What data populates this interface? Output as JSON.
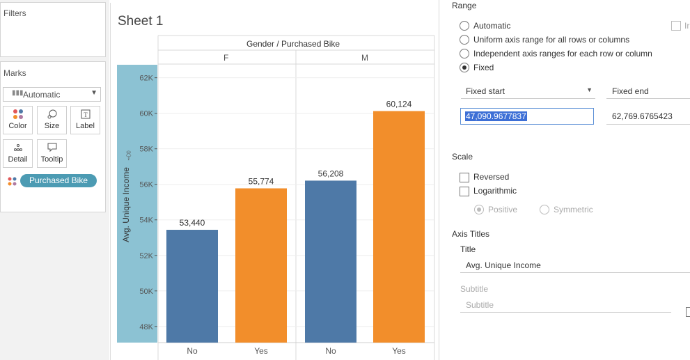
{
  "left_pane": {
    "filters_title": "Filters",
    "marks_title": "Marks",
    "mark_type": "Automatic",
    "mark_buttons": [
      "Color",
      "Size",
      "Label",
      "Detail",
      "Tooltip"
    ],
    "pill_label": "Purchased Bike"
  },
  "sheet": {
    "title": "Sheet 1",
    "column_header": "Gender / Purchased Bike",
    "panes": [
      "F",
      "M"
    ],
    "x_labels": [
      "No",
      "Yes",
      "No",
      "Yes"
    ]
  },
  "chart_data": {
    "type": "bar",
    "ylabel": "Avg. Unique Income",
    "ylim": [
      47090.9677837,
      62769.6765423
    ],
    "y_ticks": [
      48000,
      50000,
      52000,
      54000,
      56000,
      58000,
      60000,
      62000
    ],
    "y_tick_labels": [
      "48K",
      "50K",
      "52K",
      "54K",
      "56K",
      "58K",
      "60K",
      "62K"
    ],
    "categories": [
      "F / No",
      "F / Yes",
      "M / No",
      "M / Yes"
    ],
    "values": [
      53440,
      55774,
      56208,
      60124
    ],
    "value_labels": [
      "53,440",
      "55,774",
      "56,208",
      "60,124"
    ],
    "colors": [
      "#4e79a7",
      "#f28e2b",
      "#4e79a7",
      "#f28e2b"
    ]
  },
  "format_pane": {
    "range_title": "Range",
    "range_options": [
      "Automatic",
      "Uniform axis range for all rows or columns",
      "Independent axis ranges for each row or column",
      "Fixed"
    ],
    "range_selected": "Fixed",
    "include_label": "Ir",
    "fixed_start_label": "Fixed start",
    "fixed_end_label": "Fixed end",
    "fixed_start_value": "47,090.9677837",
    "fixed_end_value": "62,769.6765423",
    "scale_title": "Scale",
    "reversed_label": "Reversed",
    "logarithmic_label": "Logarithmic",
    "positive_label": "Positive",
    "symmetric_label": "Symmetric",
    "axis_titles_title": "Axis Titles",
    "title_label": "Title",
    "title_value": "Avg. Unique Income",
    "subtitle_label": "Subtitle",
    "subtitle_placeholder": "Subtitle"
  }
}
